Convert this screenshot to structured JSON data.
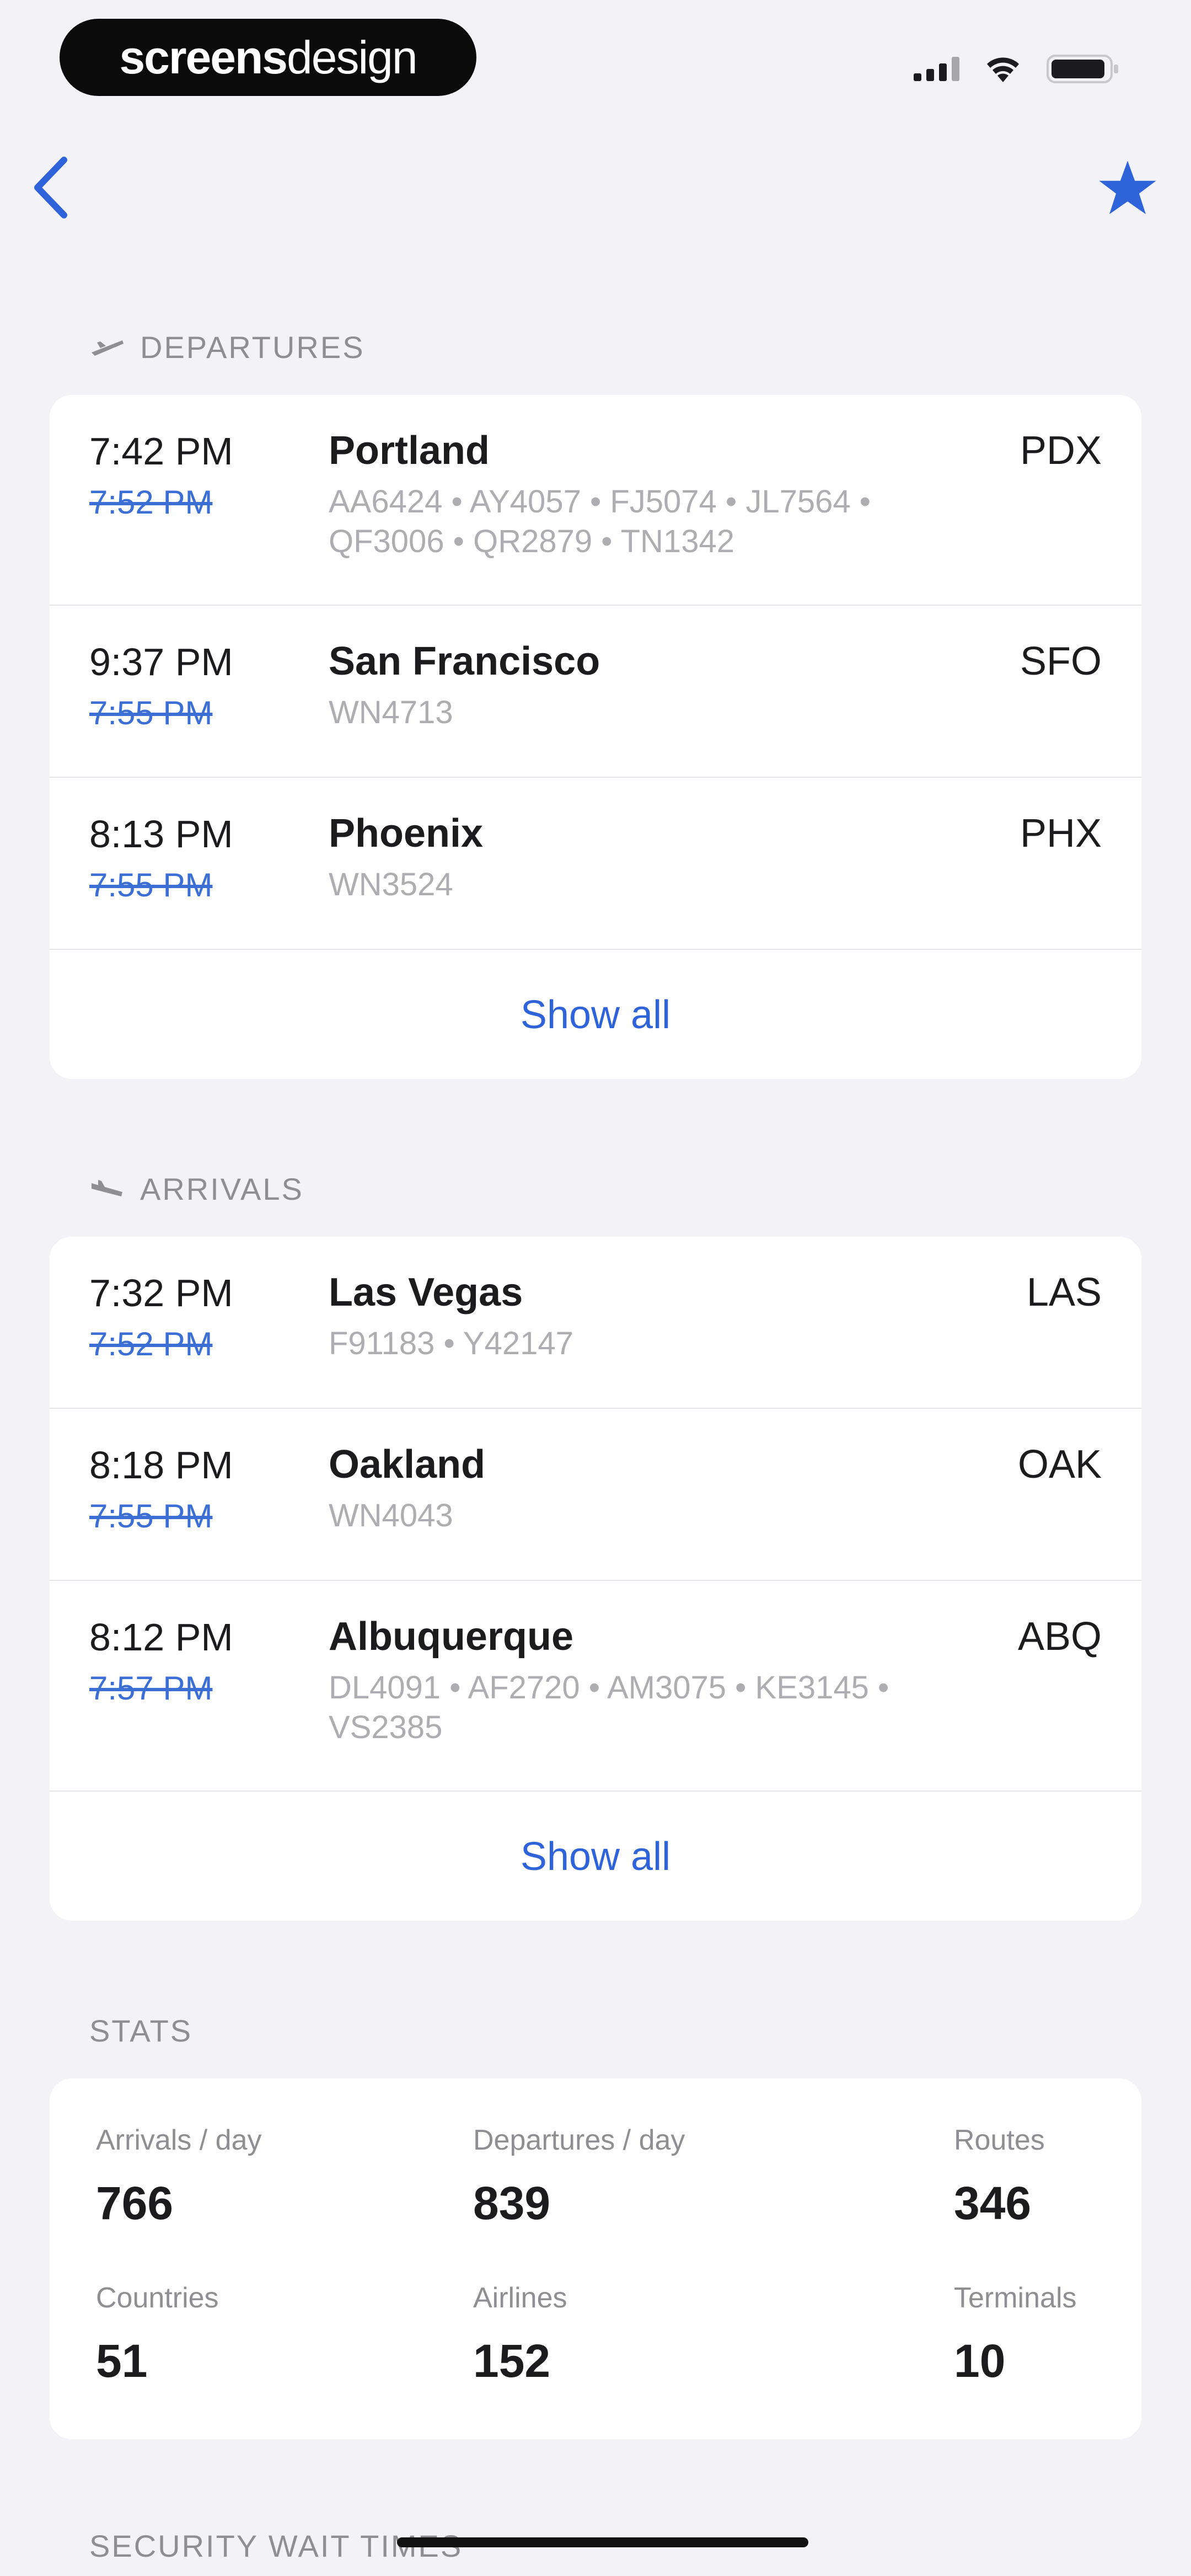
{
  "status_bar": {
    "brand_bold": "screens",
    "brand_light": "design"
  },
  "nav": {
    "back_icon": "chevron-left-icon",
    "favorite_icon": "star-icon",
    "accent_color": "#2f63d9"
  },
  "departures": {
    "header": "DEPARTURES",
    "icon": "plane-departure-icon",
    "rows": [
      {
        "time": "7:42 PM",
        "scheduled": "7:52 PM",
        "city": "Portland",
        "code": "PDX",
        "flights": "AA6424 • AY4057 • FJ5074 • JL7564 • QF3006 • QR2879 • TN1342"
      },
      {
        "time": "9:37 PM",
        "scheduled": "7:55 PM",
        "city": "San Francisco",
        "code": "SFO",
        "flights": "WN4713"
      },
      {
        "time": "8:13 PM",
        "scheduled": "7:55 PM",
        "city": "Phoenix",
        "code": "PHX",
        "flights": "WN3524"
      }
    ],
    "show_all": "Show all"
  },
  "arrivals": {
    "header": "ARRIVALS",
    "icon": "plane-arrival-icon",
    "rows": [
      {
        "time": "7:32 PM",
        "scheduled": "7:52 PM",
        "city": "Las Vegas",
        "code": "LAS",
        "flights": "F91183 • Y42147"
      },
      {
        "time": "8:18 PM",
        "scheduled": "7:55 PM",
        "city": "Oakland",
        "code": "OAK",
        "flights": "WN4043"
      },
      {
        "time": "8:12 PM",
        "scheduled": "7:57 PM",
        "city": "Albuquerque",
        "code": "ABQ",
        "flights": "DL4091 • AF2720 • AM3075 • KE3145 • VS2385"
      }
    ],
    "show_all": "Show all"
  },
  "stats": {
    "header": "STATS",
    "items": [
      {
        "label": "Arrivals / day",
        "value": "766"
      },
      {
        "label": "Departures / day",
        "value": "839"
      },
      {
        "label": "Routes",
        "value": "346"
      },
      {
        "label": "Countries",
        "value": "51"
      },
      {
        "label": "Airlines",
        "value": "152"
      },
      {
        "label": "Terminals",
        "value": "10"
      }
    ]
  },
  "security": {
    "header": "SECURITY WAIT TIMES"
  }
}
